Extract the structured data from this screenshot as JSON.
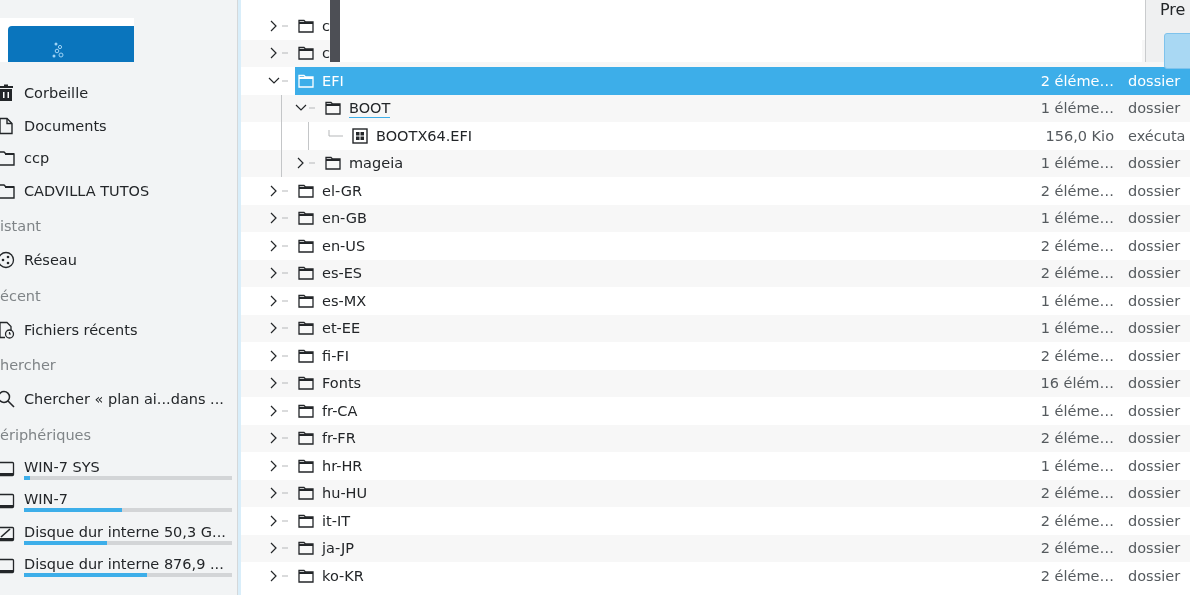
{
  "sidebar": {
    "sections": [
      {
        "items": [
          {
            "label": "Corbeille",
            "kind": "trash"
          },
          {
            "label": "Documents",
            "kind": "document"
          },
          {
            "label": "ccp",
            "kind": "folder"
          },
          {
            "label": "CADVILLA TUTOS",
            "kind": "folder"
          }
        ]
      },
      {
        "header": "istant",
        "items": [
          {
            "label": "Réseau",
            "kind": "network"
          }
        ]
      },
      {
        "header": "écent",
        "items": [
          {
            "label": "Fichiers récents",
            "kind": "recent"
          }
        ]
      },
      {
        "header": "hercher",
        "items": [
          {
            "label": "Chercher « plan ai...dans ...",
            "kind": "search"
          }
        ]
      },
      {
        "header": "ériphériques",
        "items": [
          {
            "label": "WIN-7 SYS",
            "kind": "drive",
            "level": 0.03
          },
          {
            "label": "WIN-7",
            "kind": "drive",
            "level": 0.47
          },
          {
            "label": "Disque dur interne 50,3 G...",
            "kind": "drive-check",
            "level": 0.4
          },
          {
            "label": "Disque dur interne 876,9 ...",
            "kind": "drive",
            "level": 0.59
          }
        ]
      }
    ]
  },
  "preview": {
    "label": "Pre"
  },
  "tree": [
    {
      "name": "c",
      "kind": "folder",
      "expanded": false
    },
    {
      "name": "c",
      "kind": "folder",
      "expanded": false
    },
    {
      "name": "EFI",
      "kind": "folder",
      "expanded": true,
      "selected": true,
      "size": "2 éléme…",
      "type": "dossier",
      "children": [
        {
          "name": "BOOT",
          "kind": "folder",
          "expanded": true,
          "focused": true,
          "size": "1 éléme…",
          "type": "dossier",
          "children": [
            {
              "name": "BOOTX64.EFI",
              "kind": "executable",
              "size": "156,0 Kio",
              "type": "exécuta"
            }
          ]
        },
        {
          "name": "mageia",
          "kind": "folder",
          "expanded": false,
          "size": "1 éléme…",
          "type": "dossier"
        }
      ]
    },
    {
      "name": "el-GR",
      "kind": "folder",
      "expanded": false,
      "size": "2 éléme…",
      "type": "dossier"
    },
    {
      "name": "en-GB",
      "kind": "folder",
      "expanded": false,
      "size": "1 éléme…",
      "type": "dossier"
    },
    {
      "name": "en-US",
      "kind": "folder",
      "expanded": false,
      "size": "2 éléme…",
      "type": "dossier"
    },
    {
      "name": "es-ES",
      "kind": "folder",
      "expanded": false,
      "size": "2 éléme…",
      "type": "dossier"
    },
    {
      "name": "es-MX",
      "kind": "folder",
      "expanded": false,
      "size": "1 éléme…",
      "type": "dossier"
    },
    {
      "name": "et-EE",
      "kind": "folder",
      "expanded": false,
      "size": "1 éléme…",
      "type": "dossier"
    },
    {
      "name": "fi-FI",
      "kind": "folder",
      "expanded": false,
      "size": "2 éléme…",
      "type": "dossier"
    },
    {
      "name": "Fonts",
      "kind": "folder",
      "expanded": false,
      "size": "16 élém…",
      "type": "dossier"
    },
    {
      "name": "fr-CA",
      "kind": "folder",
      "expanded": false,
      "size": "1 éléme…",
      "type": "dossier"
    },
    {
      "name": "fr-FR",
      "kind": "folder",
      "expanded": false,
      "size": "2 éléme…",
      "type": "dossier"
    },
    {
      "name": "hr-HR",
      "kind": "folder",
      "expanded": false,
      "size": "1 éléme…",
      "type": "dossier"
    },
    {
      "name": "hu-HU",
      "kind": "folder",
      "expanded": false,
      "size": "2 éléme…",
      "type": "dossier"
    },
    {
      "name": "it-IT",
      "kind": "folder",
      "expanded": false,
      "size": "2 éléme…",
      "type": "dossier"
    },
    {
      "name": "ja-JP",
      "kind": "folder",
      "expanded": false,
      "size": "2 éléme…",
      "type": "dossier"
    },
    {
      "name": "ko-KR",
      "kind": "folder",
      "expanded": false,
      "size": "2 éléme…",
      "type": "dossier"
    }
  ]
}
